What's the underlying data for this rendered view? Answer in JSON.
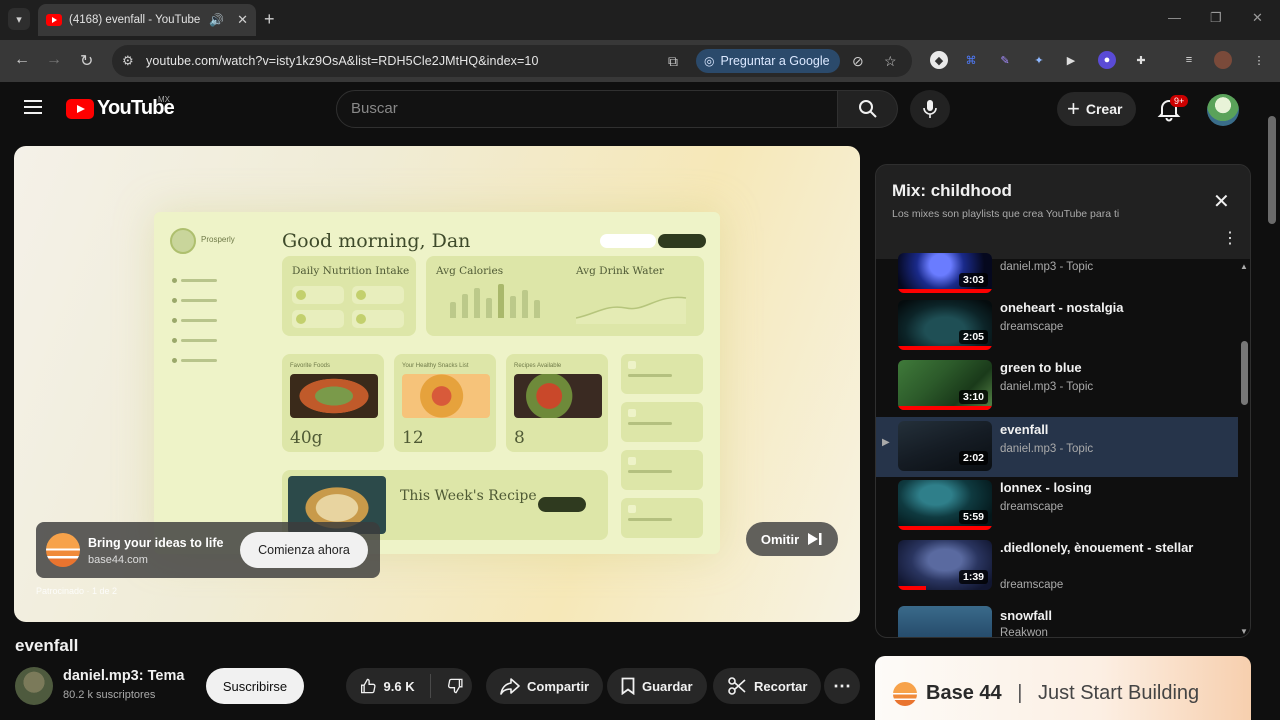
{
  "browser": {
    "tab_title": "(4168) evenfall - YouTube",
    "url": "youtube.com/watch?v=isty1kz9OsA&list=RDH5Cle2JMtHQ&index=10",
    "ask_google": "Preguntar a Google"
  },
  "masthead": {
    "logo_text": "YouTube",
    "country_code": "MX",
    "search_placeholder": "Buscar",
    "create_label": "Crear",
    "notif_count": "9+"
  },
  "player": {
    "mock": {
      "brand": "Prosperly",
      "greeting": "Good morning, Dan",
      "card_nutrients": "Daily Nutrition Intake",
      "card_calories": "Avg Calories",
      "card_water": "Avg Drink Water",
      "food1_label": "Favorite Foods",
      "food2_label": "Your Healthy Snacks List",
      "food3_label": "Recipes Available",
      "food1_value": "40g",
      "food2_value": "12",
      "food3_value": "8",
      "recipe_title": "This Week's Recipe"
    },
    "ad": {
      "title": "Bring your ideas to life",
      "domain": "base44.com",
      "cta": "Comienza ahora",
      "caption": "Patrocinado · 1 de 2"
    },
    "skip_label": "Omitir"
  },
  "video": {
    "title": "evenfall",
    "channel": "daniel.mp3: Tema",
    "subscribers": "80.2 k suscriptores",
    "subscribe_label": "Suscribirse",
    "likes": "9.6 K",
    "share_label": "Compartir",
    "save_label": "Guardar",
    "clip_label": "Recortar"
  },
  "mix": {
    "title": "Mix: childhood",
    "subtitle": "Los mixes son playlists que crea YouTube para ti",
    "items": [
      {
        "title": "",
        "channel": "daniel.mp3 - Topic",
        "duration": "3:03"
      },
      {
        "title": "oneheart - nostalgia",
        "channel": "dreamscape",
        "duration": "2:05"
      },
      {
        "title": "green to blue",
        "channel": "daniel.mp3 - Topic",
        "duration": "3:10"
      },
      {
        "title": "evenfall",
        "channel": "daniel.mp3 - Topic",
        "duration": "2:02"
      },
      {
        "title": "lonnex - losing",
        "channel": "dreamscape",
        "duration": "5:59"
      },
      {
        "title": ".diedlonely, ènouement - stellar",
        "channel": "dreamscape",
        "duration": "1:39"
      },
      {
        "title": "snowfall",
        "channel": "Reakwon",
        "duration": ""
      }
    ]
  },
  "banner": {
    "brand": "Base 44",
    "separator": "|",
    "tagline": "Just Start Building"
  },
  "colors": {
    "youtube_red": "#ff0000",
    "page_bg": "#0f0f0f",
    "active_row": "#26344a"
  }
}
